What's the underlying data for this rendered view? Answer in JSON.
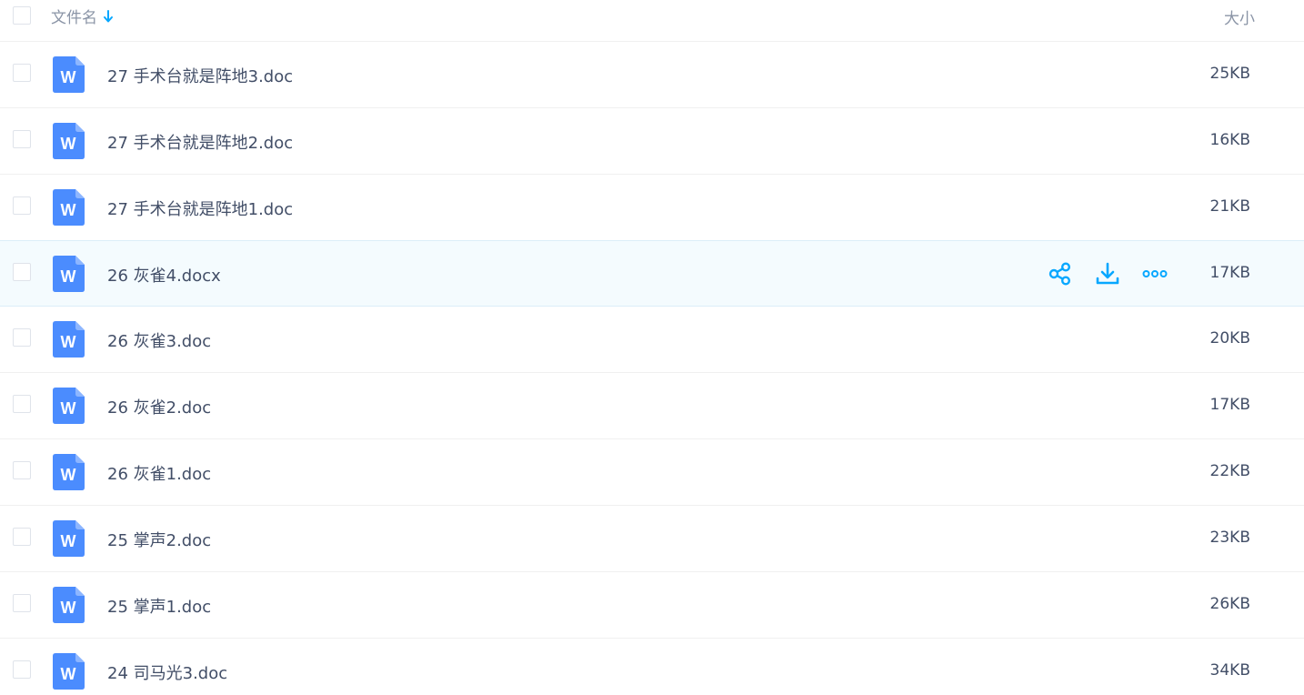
{
  "header": {
    "name_label": "文件名",
    "size_label": "大小",
    "sort_icon": "arrow-down-icon"
  },
  "colors": {
    "accent": "#06a7ff",
    "word_icon_blue": "#4b8cfe",
    "text": "#424e67",
    "header_text": "#8a94a6",
    "active_row_bg": "#f4fbfe"
  },
  "row_actions": {
    "share_icon": "share-icon",
    "download_icon": "download-icon",
    "more_icon": "more-icon"
  },
  "files": [
    {
      "name": "27 手术台就是阵地3.doc",
      "size": "25KB"
    },
    {
      "name": "27 手术台就是阵地2.doc",
      "size": "16KB"
    },
    {
      "name": "27 手术台就是阵地1.doc",
      "size": "21KB"
    },
    {
      "name": "26 灰雀4.docx",
      "size": "17KB",
      "hovered": true
    },
    {
      "name": "26 灰雀3.doc",
      "size": "20KB"
    },
    {
      "name": "26 灰雀2.doc",
      "size": "17KB"
    },
    {
      "name": "26 灰雀1.doc",
      "size": "22KB"
    },
    {
      "name": "25 掌声2.doc",
      "size": "23KB"
    },
    {
      "name": "25 掌声1.doc",
      "size": "26KB"
    },
    {
      "name": "24 司马光3.doc",
      "size": "34KB"
    }
  ]
}
